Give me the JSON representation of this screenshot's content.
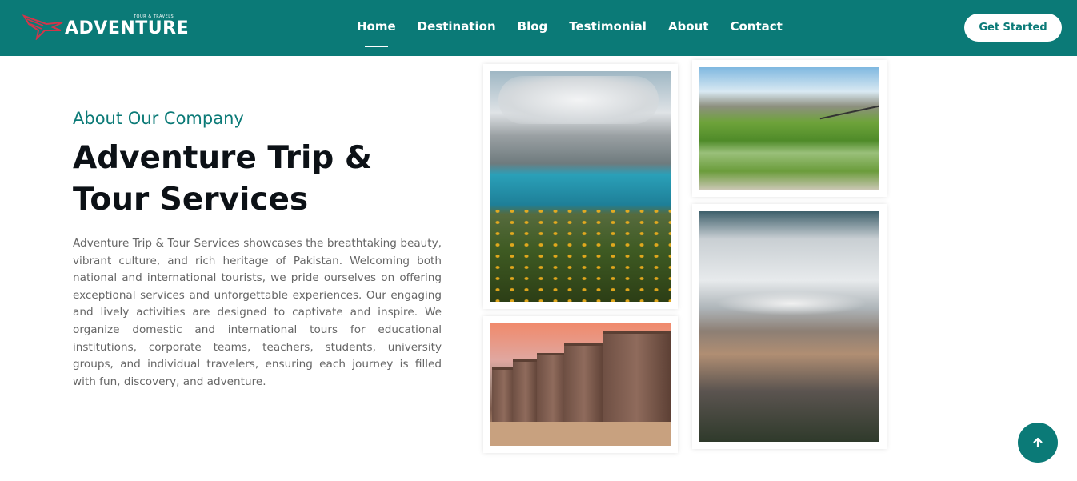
{
  "brand": {
    "name": "ADVENTURE",
    "tagline": "TOUR & TRAVELS",
    "accent_color": "#0b7a77"
  },
  "nav": {
    "items": [
      {
        "label": "Home",
        "active": true
      },
      {
        "label": "Destination",
        "active": false
      },
      {
        "label": "Blog",
        "active": false
      },
      {
        "label": "Testimonial",
        "active": false
      },
      {
        "label": "About",
        "active": false
      },
      {
        "label": "Contact",
        "active": false
      }
    ],
    "cta_label": "Get Started"
  },
  "about": {
    "eyebrow": "About Our Company",
    "title": "Adventure Trip & Tour Services",
    "paragraph": "Adventure Trip & Tour Services showcases the breathtaking beauty, vibrant culture, and rich heritage of Pakistan. Welcoming both national and international tourists, we pride ourselves on offering exceptional services and unforgettable experiences. Our engaging and lively activities are designed to captivate and inspire. We organize domestic and international tours for educational institutions, corporate teams, teachers, students, university groups, and individual travelers, ensuring each journey is filled with fun, discovery, and adventure."
  },
  "gallery": {
    "photos": [
      "lake-flowers-photo",
      "green-lake-bridge-photo",
      "desert-fort-camels-photo",
      "snowy-mountain-photo"
    ]
  },
  "scroll_top": {
    "icon": "arrow-up-icon"
  }
}
